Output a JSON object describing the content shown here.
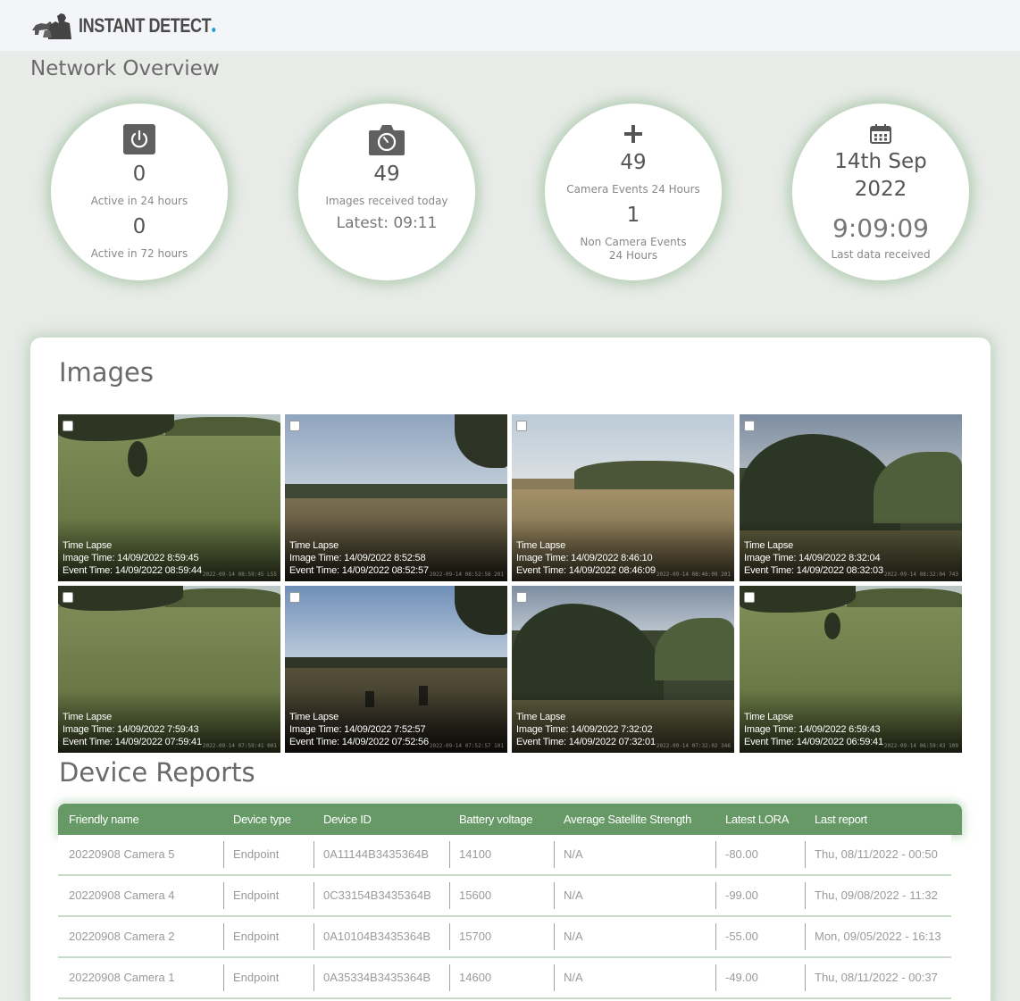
{
  "header": {
    "logo_text": "INSTANT DETECT"
  },
  "page_title": "Network Overview",
  "stats": {
    "active": {
      "active_24_value": "0",
      "active_24_label": "Active in 24 hours",
      "active_72_value": "0",
      "active_72_label": "Active in 72 hours",
      "icon": "power-icon"
    },
    "images": {
      "value": "49",
      "label": "Images received today",
      "latest": "Latest: 09:11",
      "icon": "camera-icon"
    },
    "events": {
      "camera_value": "49",
      "camera_label": "Camera Events 24 Hours",
      "noncam_value": "1",
      "noncam_label": "Non Camera Events 24 Hours",
      "icon": "plus-icon"
    },
    "last": {
      "date_line1": "14th Sep",
      "date_line2": "2022",
      "time": "9:09:09",
      "label": "Last data received",
      "icon": "calendar-icon"
    }
  },
  "images_section": {
    "title": "Images",
    "items": [
      {
        "type": "Time Lapse",
        "image_time": "Image Time: 14/09/2022 8:59:45",
        "event_time": "Event Time: 14/09/2022 08:59:44",
        "stamp": "2022-09-14 08:59:45 L55"
      },
      {
        "type": "Time Lapse",
        "image_time": "Image Time: 14/09/2022 8:52:58",
        "event_time": "Event Time: 14/09/2022 08:52:57",
        "stamp": "2022-09-14 08:52:58 201"
      },
      {
        "type": "Time Lapse",
        "image_time": "Image Time: 14/09/2022 8:46:10",
        "event_time": "Event Time: 14/09/2022 08:46:09",
        "stamp": "2022-09-14 08:46:09 201"
      },
      {
        "type": "Time Lapse",
        "image_time": "Image Time: 14/09/2022 8:32:04",
        "event_time": "Event Time: 14/09/2022 08:32:03",
        "stamp": "2022-09-14 08:32:04 743"
      },
      {
        "type": "Time Lapse",
        "image_time": "Image Time: 14/09/2022 7:59:43",
        "event_time": "Event Time: 14/09/2022 07:59:41",
        "stamp": "2022-09-14 07:59:41 001"
      },
      {
        "type": "Time Lapse",
        "image_time": "Image Time: 14/09/2022 7:52:57",
        "event_time": "Event Time: 14/09/2022 07:52:56",
        "stamp": "2022-09-14 07:52:57 101"
      },
      {
        "type": "Time Lapse",
        "image_time": "Image Time: 14/09/2022 7:32:02",
        "event_time": "Event Time: 14/09/2022 07:32:01",
        "stamp": "2022-09-14 07:32:02 346"
      },
      {
        "type": "Time Lapse",
        "image_time": "Image Time: 14/09/2022 6:59:43",
        "event_time": "Event Time: 14/09/2022 06:59:41",
        "stamp": "2022-09-14 06:59:43 109"
      }
    ]
  },
  "reports_section": {
    "title": "Device Reports",
    "columns": [
      "Friendly name",
      "Device type",
      "Device ID",
      "Battery voltage",
      "Average Satellite Strength",
      "Latest LORA",
      "Last report"
    ],
    "rows": [
      [
        "20220908 Camera 5",
        "Endpoint",
        "0A11144B3435364B",
        "14100",
        "N/A",
        "-80.00",
        "Thu, 08/11/2022 - 00:50"
      ],
      [
        "20220908 Camera 4",
        "Endpoint",
        "0C33154B3435364B",
        "15600",
        "N/A",
        "-99.00",
        "Thu, 09/08/2022 - 11:32"
      ],
      [
        "20220908 Camera 2",
        "Endpoint",
        "0A10104B3435364B",
        "15700",
        "N/A",
        "-55.00",
        "Mon, 09/05/2022 - 16:13"
      ],
      [
        "20220908 Camera 1",
        "Endpoint",
        "0A35334B3435364B",
        "14600",
        "N/A",
        "-49.00",
        "Thu, 08/11/2022 - 00:37"
      ]
    ]
  },
  "colors": {
    "accent_green": "#669966",
    "brand_dot": "#1e9ad6",
    "page_bg": "#e8ebe8"
  }
}
